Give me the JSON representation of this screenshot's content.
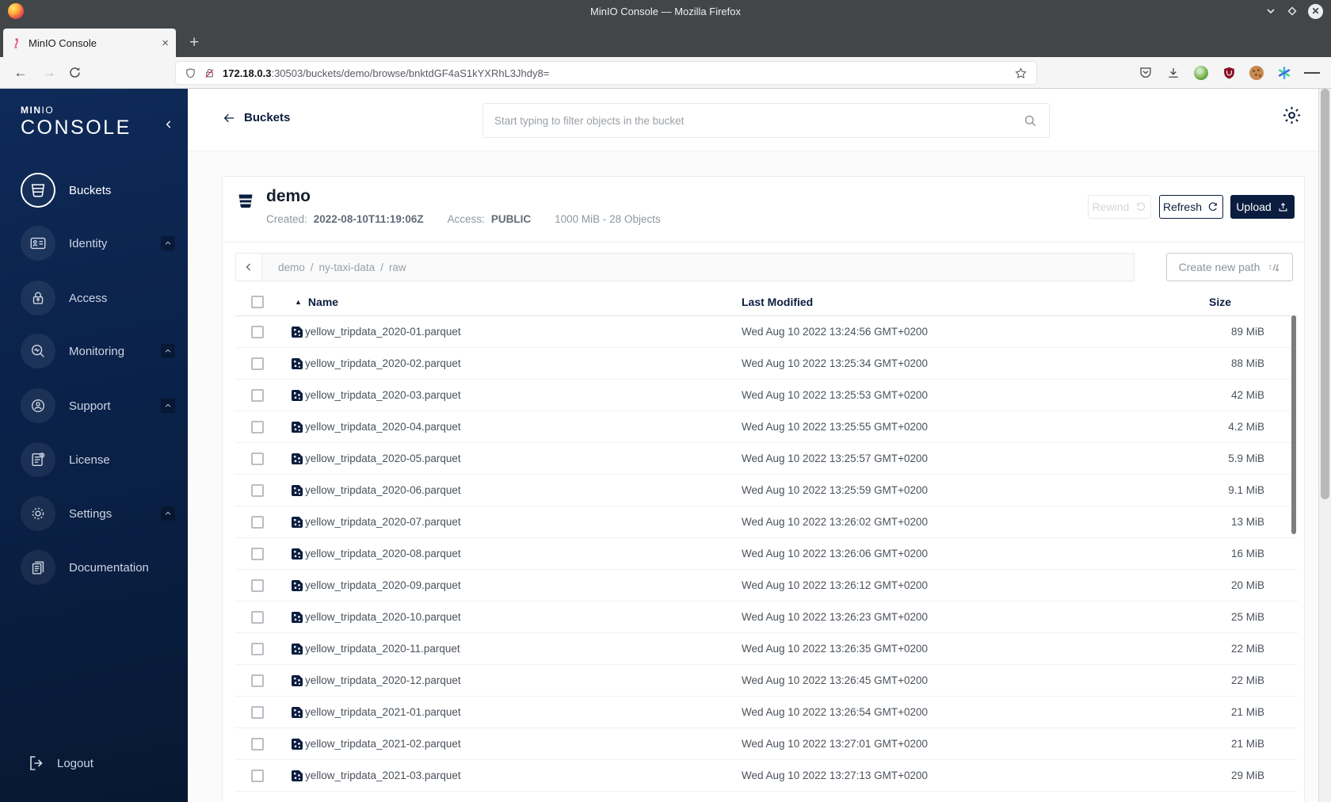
{
  "window": {
    "title": "MinIO Console — Mozilla Firefox"
  },
  "tab": {
    "title": "MinIO Console",
    "close_glyph": "×",
    "new_tab_glyph": "+"
  },
  "urlbar": {
    "host": "172.18.0.3",
    "path": ":30503/buckets/demo/browse/bnktdGF4aS1kYXRhL3Jhdy8="
  },
  "toolbar_icons": [
    "pocket-icon",
    "download-icon",
    "privacy-badger-icon",
    "ublock-origin-icon",
    "cookie-icon",
    "containers-icon",
    "menu-icon"
  ],
  "sidebar": {
    "logo_bold": "MIN",
    "logo_light": "IO",
    "logo_console": "CONSOLE",
    "items": [
      {
        "label": "Buckets",
        "active": true
      },
      {
        "label": "Identity",
        "expandable": true
      },
      {
        "label": "Access"
      },
      {
        "label": "Monitoring",
        "expandable": true
      },
      {
        "label": "Support",
        "expandable": true
      },
      {
        "label": "License"
      },
      {
        "label": "Settings",
        "expandable": true
      },
      {
        "label": "Documentation"
      }
    ],
    "logout_label": "Logout"
  },
  "topbar": {
    "back_label": "Buckets",
    "search_placeholder": "Start typing to filter objects in the bucket"
  },
  "bucket": {
    "name": "demo",
    "created_label": "Created:",
    "created_value": "2022-08-10T11:19:06Z",
    "access_label": "Access:",
    "access_value": "PUBLIC",
    "usage": "1000 MiB - 28 Objects",
    "rewind_label": "Rewind",
    "refresh_label": "Refresh",
    "upload_label": "Upload"
  },
  "browse": {
    "breadcrumb_parts": [
      "demo",
      "ny-taxi-data",
      "raw"
    ],
    "separator": "/",
    "create_path_label": "Create new path"
  },
  "table": {
    "headers": {
      "name": "Name",
      "modified": "Last Modified",
      "size": "Size"
    },
    "sort_glyph": "▲",
    "rows": [
      {
        "name": "yellow_tripdata_2020-01.parquet",
        "modified": "Wed Aug 10 2022 13:24:56 GMT+0200",
        "size": "89 MiB"
      },
      {
        "name": "yellow_tripdata_2020-02.parquet",
        "modified": "Wed Aug 10 2022 13:25:34 GMT+0200",
        "size": "88 MiB"
      },
      {
        "name": "yellow_tripdata_2020-03.parquet",
        "modified": "Wed Aug 10 2022 13:25:53 GMT+0200",
        "size": "42 MiB"
      },
      {
        "name": "yellow_tripdata_2020-04.parquet",
        "modified": "Wed Aug 10 2022 13:25:55 GMT+0200",
        "size": "4.2 MiB"
      },
      {
        "name": "yellow_tripdata_2020-05.parquet",
        "modified": "Wed Aug 10 2022 13:25:57 GMT+0200",
        "size": "5.9 MiB"
      },
      {
        "name": "yellow_tripdata_2020-06.parquet",
        "modified": "Wed Aug 10 2022 13:25:59 GMT+0200",
        "size": "9.1 MiB"
      },
      {
        "name": "yellow_tripdata_2020-07.parquet",
        "modified": "Wed Aug 10 2022 13:26:02 GMT+0200",
        "size": "13 MiB"
      },
      {
        "name": "yellow_tripdata_2020-08.parquet",
        "modified": "Wed Aug 10 2022 13:26:06 GMT+0200",
        "size": "16 MiB"
      },
      {
        "name": "yellow_tripdata_2020-09.parquet",
        "modified": "Wed Aug 10 2022 13:26:12 GMT+0200",
        "size": "20 MiB"
      },
      {
        "name": "yellow_tripdata_2020-10.parquet",
        "modified": "Wed Aug 10 2022 13:26:23 GMT+0200",
        "size": "25 MiB"
      },
      {
        "name": "yellow_tripdata_2020-11.parquet",
        "modified": "Wed Aug 10 2022 13:26:35 GMT+0200",
        "size": "22 MiB"
      },
      {
        "name": "yellow_tripdata_2020-12.parquet",
        "modified": "Wed Aug 10 2022 13:26:45 GMT+0200",
        "size": "22 MiB"
      },
      {
        "name": "yellow_tripdata_2021-01.parquet",
        "modified": "Wed Aug 10 2022 13:26:54 GMT+0200",
        "size": "21 MiB"
      },
      {
        "name": "yellow_tripdata_2021-02.parquet",
        "modified": "Wed Aug 10 2022 13:27:01 GMT+0200",
        "size": "21 MiB"
      },
      {
        "name": "yellow_tripdata_2021-03.parquet",
        "modified": "Wed Aug 10 2022 13:27:13 GMT+0200",
        "size": "29 MiB"
      }
    ]
  }
}
